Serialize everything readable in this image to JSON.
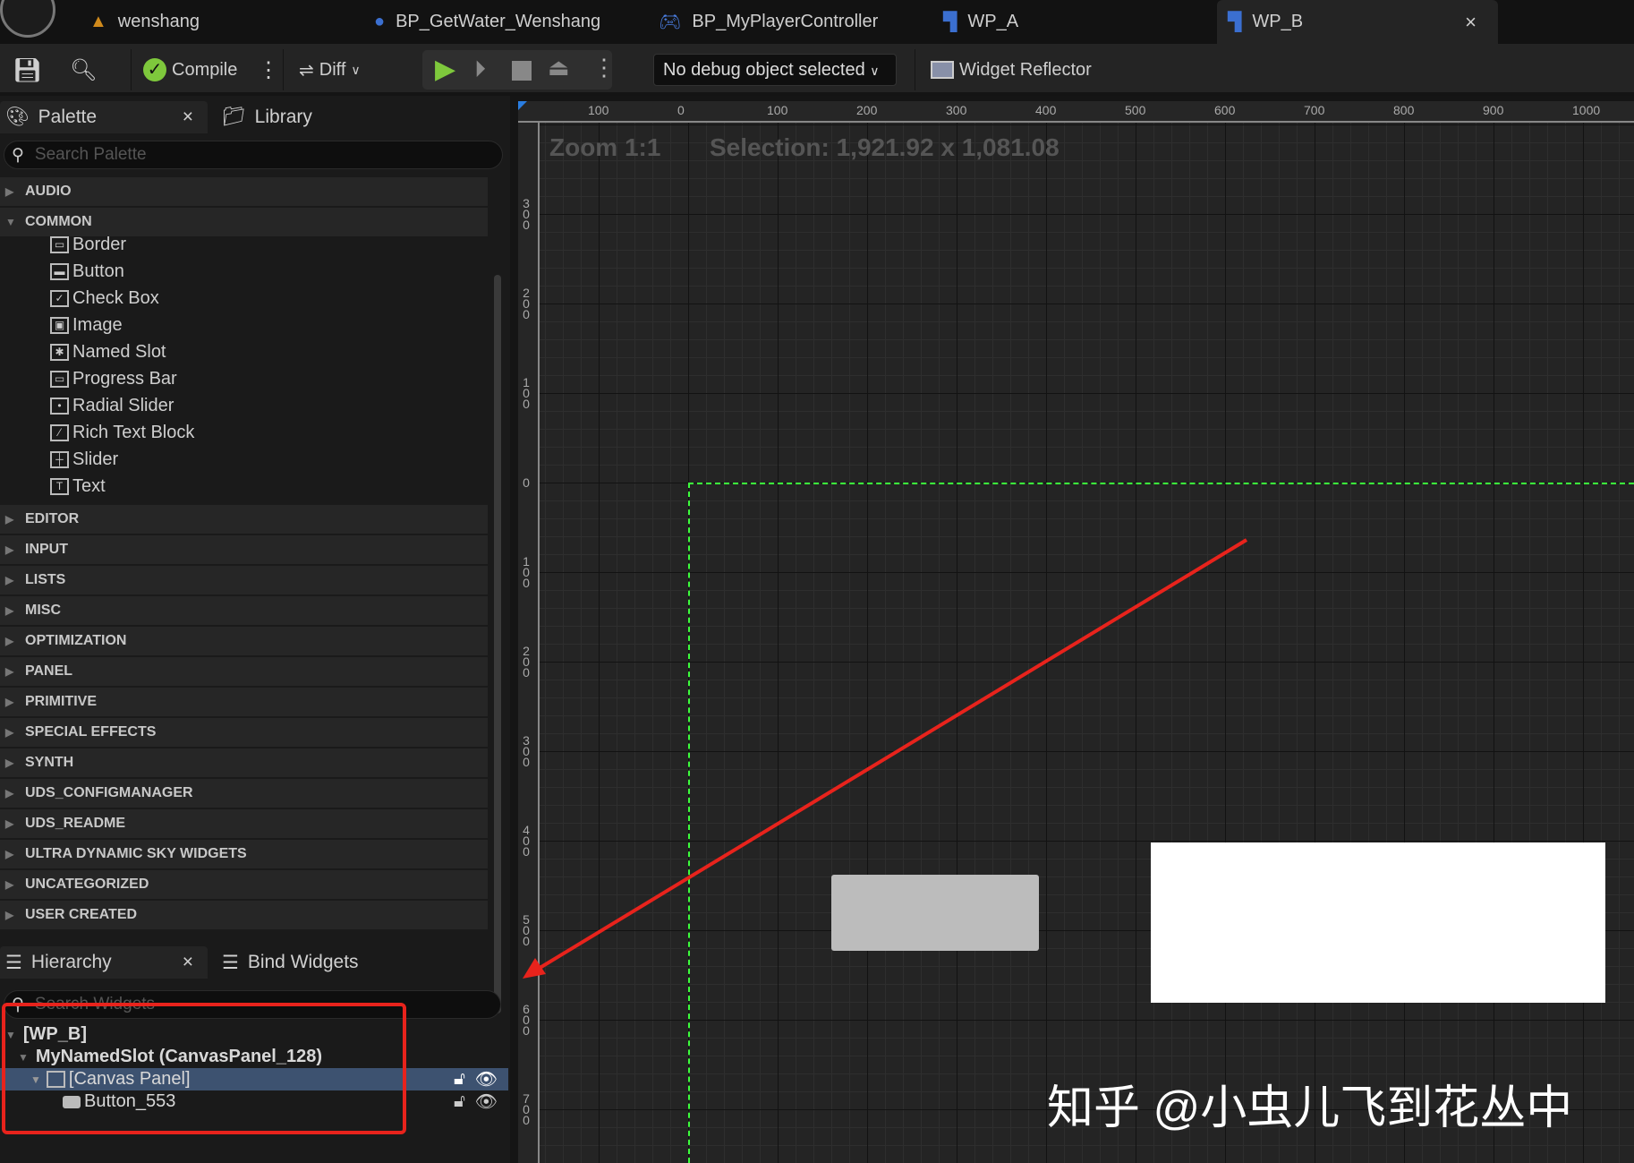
{
  "tabs": [
    {
      "label": "wenshang",
      "icon": "level-icon"
    },
    {
      "label": "BP_GetWater_Wenshang",
      "icon": "blueprint-actor-icon"
    },
    {
      "label": "BP_MyPlayerController",
      "icon": "gamepad-icon"
    },
    {
      "label": "WP_A",
      "icon": "widget-blueprint-icon"
    },
    {
      "label": "WP_B",
      "icon": "widget-blueprint-icon",
      "active": true
    }
  ],
  "tab_close": "×",
  "toolbar": {
    "compile": "Compile",
    "diff": "Diff",
    "debug_select": "No debug object selected",
    "widget_reflector": "Widget Reflector"
  },
  "palette": {
    "tab": "Palette",
    "close": "×",
    "library": "Library",
    "search_placeholder": "Search Palette",
    "categories_before": [
      "AUDIO",
      "COMMON"
    ],
    "common_items": [
      "Border",
      "Button",
      "Check Box",
      "Image",
      "Named Slot",
      "Progress Bar",
      "Radial Slider",
      "Rich Text Block",
      "Slider",
      "Text"
    ],
    "common_icons": [
      "▭",
      "▬",
      "✓",
      "▣",
      "✱",
      "▭",
      "•",
      "⁄",
      "┼",
      "T"
    ],
    "categories_after": [
      "EDITOR",
      "INPUT",
      "LISTS",
      "MISC",
      "OPTIMIZATION",
      "PANEL",
      "PRIMITIVE",
      "SPECIAL EFFECTS",
      "SYNTH",
      "UDS_CONFIGMANAGER",
      "UDS_README",
      "ULTRA DYNAMIC SKY WIDGETS",
      "UNCATEGORIZED",
      "USER CREATED"
    ]
  },
  "hierarchy": {
    "tab": "Hierarchy",
    "close": "×",
    "bind_widgets": "Bind Widgets",
    "search_placeholder": "Search Widgets",
    "rows": [
      "[WP_B]",
      "MyNamedSlot (CanvasPanel_128)",
      "[Canvas Panel]",
      "Button_553"
    ]
  },
  "designer": {
    "zoom": "Zoom 1:1",
    "selection": "Selection: 1,921.92 x 1,081.08",
    "hruler": [
      "100",
      "0",
      "100",
      "200",
      "300",
      "400",
      "500",
      "600",
      "700",
      "800",
      "900",
      "1000"
    ],
    "vruler": [
      "300",
      "200",
      "100",
      "0",
      "100",
      "200",
      "300",
      "400",
      "500",
      "600",
      "700"
    ]
  },
  "watermark": "知乎 @小虫儿飞到花丛中",
  "colors": {
    "accent_green": "#7ec83c",
    "selection_outline": "#3cff3c",
    "annotation_red": "#e8231c",
    "selected_row": "#3d5270"
  }
}
